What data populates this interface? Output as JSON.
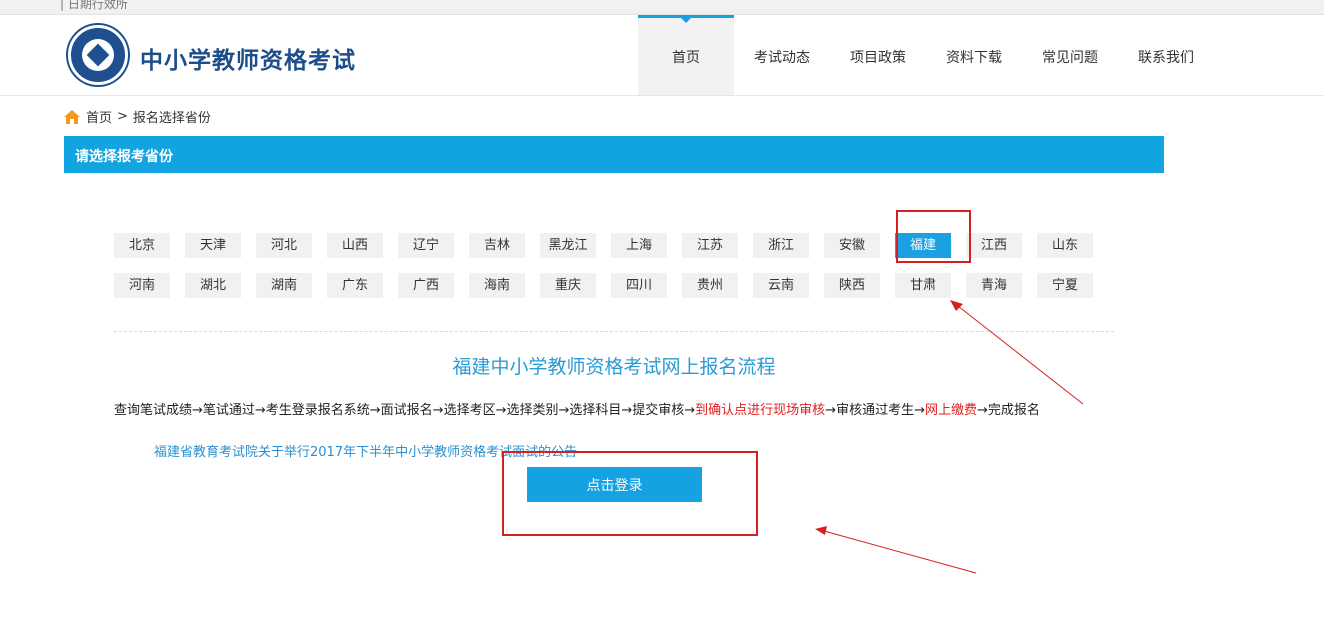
{
  "topbar": {
    "text": "| 日期行效所"
  },
  "header": {
    "site_title": "中小学教师资格考试",
    "nav": [
      "首页",
      "考试动态",
      "项目政策",
      "资料下载",
      "常见问题",
      "联系我们"
    ],
    "active_nav": "首页"
  },
  "breadcrumb": {
    "home": "首页",
    "separator": ">",
    "current": "报名选择省份"
  },
  "panel": {
    "title": "请选择报考省份"
  },
  "provinces": {
    "row1": [
      "北京",
      "天津",
      "河北",
      "山西",
      "辽宁",
      "吉林",
      "黑龙江",
      "上海",
      "江苏",
      "浙江",
      "安徽",
      "福建",
      "江西",
      "山东"
    ],
    "row2": [
      "河南",
      "湖北",
      "湖南",
      "广东",
      "广西",
      "海南",
      "重庆",
      "四川",
      "贵州",
      "云南",
      "陕西",
      "甘肃",
      "青海",
      "宁夏"
    ],
    "selected": "福建"
  },
  "flow": {
    "title": "福建中小学教师资格考试网上报名流程",
    "part1": "查询笔试成绩→笔试通过→考生登录报名系统→面试报名→选择考区→选择类别→选择科目→提交审核→",
    "red1": "到确认点进行现场审核",
    "part2": "→审核通过考生→",
    "red2": "网上缴费",
    "part3": "→完成报名"
  },
  "notice": {
    "link_text": "福建省教育考试院关于举行2017年下半年中小学教师资格考试面试的公告"
  },
  "login": {
    "button_label": "点击登录"
  },
  "colors": {
    "accent": "#12a3e1",
    "brand": "#1d4e8a",
    "annotation": "#d62020"
  },
  "icons": {
    "home": "home-icon",
    "logo": "logo-emblem"
  }
}
